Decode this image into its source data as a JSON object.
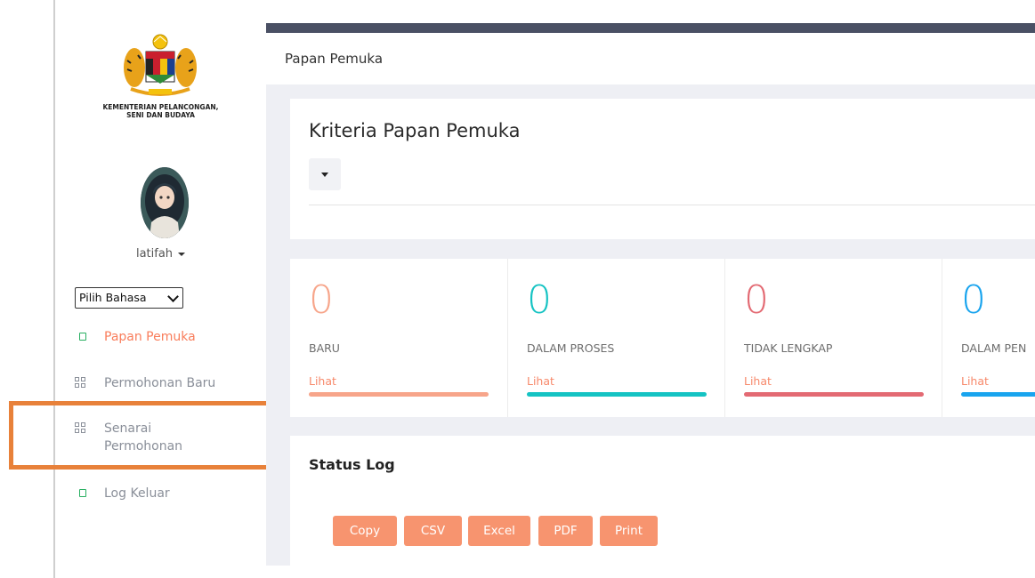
{
  "sidebar": {
    "ministry_line1": "KEMENTERIAN PELANCONGAN,",
    "ministry_line2": "SENI DAN BUDAYA",
    "username": "latifah",
    "language_select": "Pilih Bahasa",
    "nav": [
      {
        "label": "Papan Pemuka",
        "icon": "square-icon",
        "active": true
      },
      {
        "label": "Permohonan Baru",
        "icon": "grid-icon",
        "active": false
      },
      {
        "label": "Senarai Permohonan",
        "icon": "grid-icon",
        "active": false
      },
      {
        "label": "Log Keluar",
        "icon": "square-icon",
        "active": false
      }
    ]
  },
  "header": {
    "title": "Papan Pemuka"
  },
  "criteria": {
    "title": "Kriteria Papan Pemuka"
  },
  "stats": [
    {
      "value": "0",
      "label": "BARU",
      "link": "Lihat",
      "color": "#f7a58a"
    },
    {
      "value": "0",
      "label": "DALAM PROSES",
      "link": "Lihat",
      "color": "#15c3c3"
    },
    {
      "value": "0",
      "label": "TIDAK LENGKAP",
      "link": "Lihat",
      "color": "#e36a73"
    },
    {
      "value": "0",
      "label": "DALAM PEN",
      "link": "Lihat",
      "color": "#19a4ee"
    }
  ],
  "status_log": {
    "title": "Status Log",
    "buttons": [
      "Copy",
      "CSV",
      "Excel",
      "PDF",
      "Print"
    ]
  },
  "colors": {
    "accent": "#f97d5b",
    "highlight_box": "#e8813a",
    "topbar": "#4a5064",
    "button": "#f7946f"
  }
}
